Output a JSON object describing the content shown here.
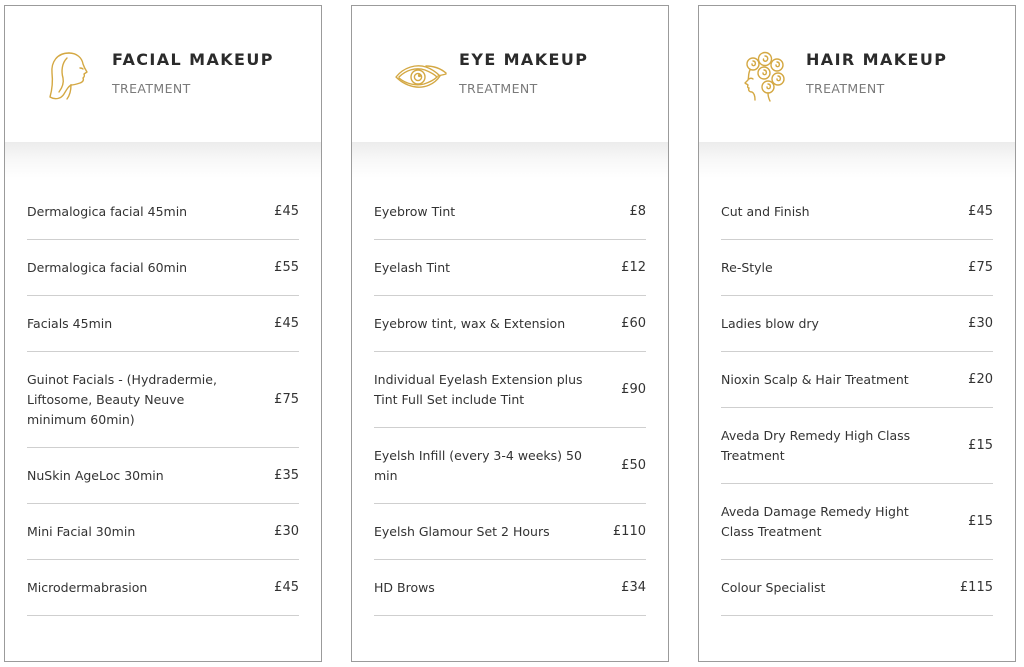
{
  "accent_color": "#d4a843",
  "cards": [
    {
      "icon": "woman-face-profile-icon",
      "title": "FACIAL MAKEUP",
      "subtitle": "TREATMENT",
      "items": [
        {
          "name": "Dermalogica facial 45min",
          "price": "£45"
        },
        {
          "name": "Dermalogica facial 60min",
          "price": "£55"
        },
        {
          "name": "Facials 45min",
          "price": "£45"
        },
        {
          "name": "Guinot Facials - (Hydradermie, Liftosome, Beauty Neuve minimum 60min)",
          "price": "£75"
        },
        {
          "name": "NuSkin AgeLoc 30min",
          "price": "£35"
        },
        {
          "name": "Mini Facial 30min",
          "price": "£30"
        },
        {
          "name": "Microdermabrasion",
          "price": "£45"
        }
      ]
    },
    {
      "icon": "eye-icon",
      "title": "EYE MAKEUP",
      "subtitle": "TREATMENT",
      "items": [
        {
          "name": "Eyebrow Tint",
          "price": "£8"
        },
        {
          "name": "Eyelash Tint",
          "price": "£12"
        },
        {
          "name": "Eyebrow tint, wax & Extension",
          "price": "£60"
        },
        {
          "name": "Individual Eyelash Extension plus Tint Full Set include Tint",
          "price": "£90"
        },
        {
          "name": "Eyelsh Infill (every 3-4 weeks) 50 min",
          "price": "£50"
        },
        {
          "name": "Eyelsh Glamour Set 2 Hours",
          "price": "£110"
        },
        {
          "name": "HD Brows",
          "price": "£34"
        }
      ]
    },
    {
      "icon": "curly-hair-head-icon",
      "title": "HAIR MAKEUP",
      "subtitle": "TREATMENT",
      "items": [
        {
          "name": "Cut and Finish",
          "price": "£45"
        },
        {
          "name": "Re-Style",
          "price": "£75"
        },
        {
          "name": "Ladies blow dry",
          "price": "£30"
        },
        {
          "name": "Nioxin Scalp & Hair Treatment",
          "price": "£20"
        },
        {
          "name": "Aveda Dry Remedy High Class Treatment",
          "price": "£15"
        },
        {
          "name": "Aveda Damage Remedy Hight Class Treatment",
          "price": "£15"
        },
        {
          "name": "Colour Specialist",
          "price": "£115"
        }
      ]
    }
  ]
}
